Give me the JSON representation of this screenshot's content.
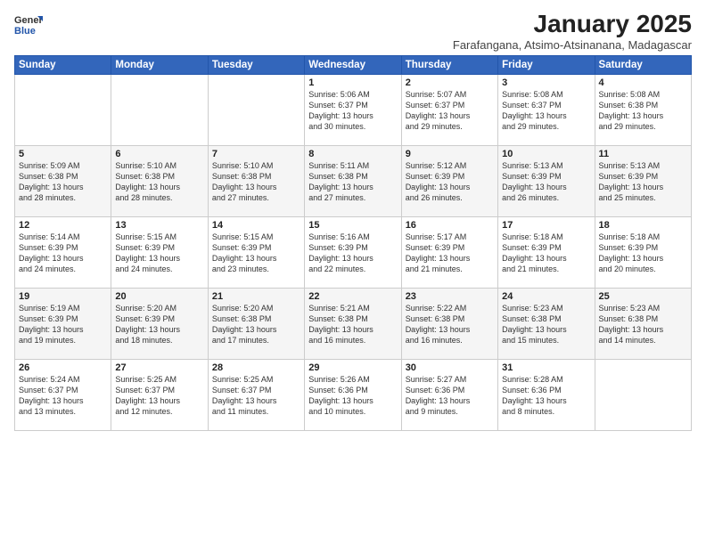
{
  "logo": {
    "general": "General",
    "blue": "Blue"
  },
  "header": {
    "title": "January 2025",
    "subtitle": "Farafangana, Atsimo-Atsinanana, Madagascar"
  },
  "weekdays": [
    "Sunday",
    "Monday",
    "Tuesday",
    "Wednesday",
    "Thursday",
    "Friday",
    "Saturday"
  ],
  "weeks": [
    [
      {
        "day": "",
        "info": ""
      },
      {
        "day": "",
        "info": ""
      },
      {
        "day": "",
        "info": ""
      },
      {
        "day": "1",
        "info": "Sunrise: 5:06 AM\nSunset: 6:37 PM\nDaylight: 13 hours\nand 30 minutes."
      },
      {
        "day": "2",
        "info": "Sunrise: 5:07 AM\nSunset: 6:37 PM\nDaylight: 13 hours\nand 29 minutes."
      },
      {
        "day": "3",
        "info": "Sunrise: 5:08 AM\nSunset: 6:37 PM\nDaylight: 13 hours\nand 29 minutes."
      },
      {
        "day": "4",
        "info": "Sunrise: 5:08 AM\nSunset: 6:38 PM\nDaylight: 13 hours\nand 29 minutes."
      }
    ],
    [
      {
        "day": "5",
        "info": "Sunrise: 5:09 AM\nSunset: 6:38 PM\nDaylight: 13 hours\nand 28 minutes."
      },
      {
        "day": "6",
        "info": "Sunrise: 5:10 AM\nSunset: 6:38 PM\nDaylight: 13 hours\nand 28 minutes."
      },
      {
        "day": "7",
        "info": "Sunrise: 5:10 AM\nSunset: 6:38 PM\nDaylight: 13 hours\nand 27 minutes."
      },
      {
        "day": "8",
        "info": "Sunrise: 5:11 AM\nSunset: 6:38 PM\nDaylight: 13 hours\nand 27 minutes."
      },
      {
        "day": "9",
        "info": "Sunrise: 5:12 AM\nSunset: 6:39 PM\nDaylight: 13 hours\nand 26 minutes."
      },
      {
        "day": "10",
        "info": "Sunrise: 5:13 AM\nSunset: 6:39 PM\nDaylight: 13 hours\nand 26 minutes."
      },
      {
        "day": "11",
        "info": "Sunrise: 5:13 AM\nSunset: 6:39 PM\nDaylight: 13 hours\nand 25 minutes."
      }
    ],
    [
      {
        "day": "12",
        "info": "Sunrise: 5:14 AM\nSunset: 6:39 PM\nDaylight: 13 hours\nand 24 minutes."
      },
      {
        "day": "13",
        "info": "Sunrise: 5:15 AM\nSunset: 6:39 PM\nDaylight: 13 hours\nand 24 minutes."
      },
      {
        "day": "14",
        "info": "Sunrise: 5:15 AM\nSunset: 6:39 PM\nDaylight: 13 hours\nand 23 minutes."
      },
      {
        "day": "15",
        "info": "Sunrise: 5:16 AM\nSunset: 6:39 PM\nDaylight: 13 hours\nand 22 minutes."
      },
      {
        "day": "16",
        "info": "Sunrise: 5:17 AM\nSunset: 6:39 PM\nDaylight: 13 hours\nand 21 minutes."
      },
      {
        "day": "17",
        "info": "Sunrise: 5:18 AM\nSunset: 6:39 PM\nDaylight: 13 hours\nand 21 minutes."
      },
      {
        "day": "18",
        "info": "Sunrise: 5:18 AM\nSunset: 6:39 PM\nDaylight: 13 hours\nand 20 minutes."
      }
    ],
    [
      {
        "day": "19",
        "info": "Sunrise: 5:19 AM\nSunset: 6:39 PM\nDaylight: 13 hours\nand 19 minutes."
      },
      {
        "day": "20",
        "info": "Sunrise: 5:20 AM\nSunset: 6:39 PM\nDaylight: 13 hours\nand 18 minutes."
      },
      {
        "day": "21",
        "info": "Sunrise: 5:20 AM\nSunset: 6:38 PM\nDaylight: 13 hours\nand 17 minutes."
      },
      {
        "day": "22",
        "info": "Sunrise: 5:21 AM\nSunset: 6:38 PM\nDaylight: 13 hours\nand 16 minutes."
      },
      {
        "day": "23",
        "info": "Sunrise: 5:22 AM\nSunset: 6:38 PM\nDaylight: 13 hours\nand 16 minutes."
      },
      {
        "day": "24",
        "info": "Sunrise: 5:23 AM\nSunset: 6:38 PM\nDaylight: 13 hours\nand 15 minutes."
      },
      {
        "day": "25",
        "info": "Sunrise: 5:23 AM\nSunset: 6:38 PM\nDaylight: 13 hours\nand 14 minutes."
      }
    ],
    [
      {
        "day": "26",
        "info": "Sunrise: 5:24 AM\nSunset: 6:37 PM\nDaylight: 13 hours\nand 13 minutes."
      },
      {
        "day": "27",
        "info": "Sunrise: 5:25 AM\nSunset: 6:37 PM\nDaylight: 13 hours\nand 12 minutes."
      },
      {
        "day": "28",
        "info": "Sunrise: 5:25 AM\nSunset: 6:37 PM\nDaylight: 13 hours\nand 11 minutes."
      },
      {
        "day": "29",
        "info": "Sunrise: 5:26 AM\nSunset: 6:36 PM\nDaylight: 13 hours\nand 10 minutes."
      },
      {
        "day": "30",
        "info": "Sunrise: 5:27 AM\nSunset: 6:36 PM\nDaylight: 13 hours\nand 9 minutes."
      },
      {
        "day": "31",
        "info": "Sunrise: 5:28 AM\nSunset: 6:36 PM\nDaylight: 13 hours\nand 8 minutes."
      },
      {
        "day": "",
        "info": ""
      }
    ]
  ]
}
